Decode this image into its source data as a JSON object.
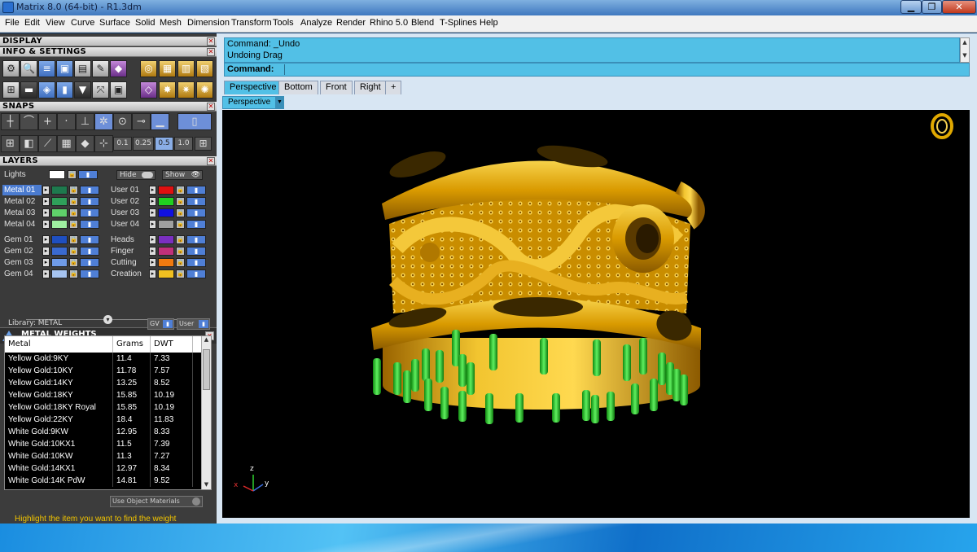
{
  "window": {
    "title": "Matrix 8.0 (64-bit) - R1.3dm",
    "min_label": "▁",
    "max_label": "❐",
    "close_label": "✕"
  },
  "menu": [
    "File",
    "Edit",
    "View",
    "Curve",
    "Surface",
    "Solid",
    "Mesh",
    "Dimension",
    "Transform",
    "Tools",
    "Analyze",
    "Render",
    "Rhino 5.0",
    "Blend",
    "T-Splines",
    "Help"
  ],
  "panels": {
    "display": "DISPLAY",
    "info": "INFO & SETTINGS",
    "snaps": "SNAPS",
    "layers": "LAYERS",
    "metal_weights": "METAL WEIGHTS"
  },
  "grid_values": [
    "0.1",
    "0.25",
    "0.5",
    "1.0"
  ],
  "layers": {
    "lights_label": "Lights",
    "hide_label": "Hide",
    "show_label": "Show",
    "left": [
      {
        "name": "Metal 01",
        "color": "#1e7a4e",
        "selected": true
      },
      {
        "name": "Metal 02",
        "color": "#2fa05a"
      },
      {
        "name": "Metal 03",
        "color": "#5fd06a"
      },
      {
        "name": "Metal 04",
        "color": "#9ff0a0"
      },
      {
        "name": "Gem 01",
        "color": "#1f4fbf"
      },
      {
        "name": "Gem 02",
        "color": "#3a6ad0"
      },
      {
        "name": "Gem 03",
        "color": "#6f9be8"
      },
      {
        "name": "Gem 04",
        "color": "#a6c4f0"
      }
    ],
    "right": [
      {
        "name": "User 01",
        "color": "#e01010"
      },
      {
        "name": "User 02",
        "color": "#20d020"
      },
      {
        "name": "User 03",
        "color": "#1010e0"
      },
      {
        "name": "User 04",
        "color": "#a0a0a0"
      },
      {
        "name": "Heads",
        "color": "#7a2fc0"
      },
      {
        "name": "Finger",
        "color": "#c0307a"
      },
      {
        "name": "Cutting",
        "color": "#f07a10"
      },
      {
        "name": "Creation",
        "color": "#f0c020"
      }
    ]
  },
  "metal_weights": {
    "library_label": "Library: METAL",
    "gv_label": "GV",
    "user_label": "User",
    "columns": [
      "Metal",
      "Grams",
      "DWT"
    ],
    "rows": [
      [
        "Yellow Gold:9KY",
        "11.4",
        "7.33"
      ],
      [
        "Yellow Gold:10KY",
        "11.78",
        "7.57"
      ],
      [
        "Yellow Gold:14KY",
        "13.25",
        "8.52"
      ],
      [
        "Yellow Gold:18KY",
        "15.85",
        "10.19"
      ],
      [
        "Yellow Gold:18KY Royal",
        "15.85",
        "10.19"
      ],
      [
        "Yellow Gold:22KY",
        "18.4",
        "11.83"
      ],
      [
        "White Gold:9KW",
        "12.95",
        "8.33"
      ],
      [
        "White Gold:10KX1",
        "11.5",
        "7.39"
      ],
      [
        "White Gold:10KW",
        "11.3",
        "7.27"
      ],
      [
        "White Gold:14KX1",
        "12.97",
        "8.34"
      ],
      [
        "White Gold:14K PdW",
        "14.81",
        "9.52"
      ]
    ],
    "use_object_materials": "Use Object Materials",
    "hint": "Highlight the item you want to find the weight"
  },
  "command": {
    "history": [
      "Command: _Undo",
      "Undoing Drag"
    ],
    "prompt": "Command:",
    "value": ""
  },
  "viewport_tabs": [
    "Perspective",
    "Bottom",
    "Front",
    "Right",
    "+"
  ],
  "viewport": {
    "name": "Perspective",
    "axis_x": "x",
    "axis_y": "y",
    "axis_z": "z"
  },
  "colors": {
    "gold": "#e0a800",
    "prongs": "#2fd02f",
    "cmd_bg": "#52c0e6"
  }
}
